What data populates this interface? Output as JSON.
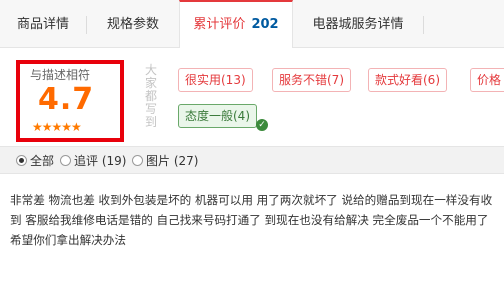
{
  "tabs": [
    {
      "label": "商品详情"
    },
    {
      "label": "规格参数"
    },
    {
      "label": "累计评价",
      "count": "202"
    },
    {
      "label": "电器城服务详情"
    }
  ],
  "rating": {
    "label": "与描述相符",
    "score": "4.7",
    "stars": 4.7,
    "stars_glyph": "★★★★★"
  },
  "vertical_label": "大家都写到",
  "tags": [
    {
      "label": "很实用(13)"
    },
    {
      "label": "服务不错(7)"
    },
    {
      "label": "款式好看(6)"
    },
    {
      "label": "价格"
    },
    {
      "label": "态度一般(4)",
      "selected": true
    }
  ],
  "filters": [
    {
      "label": "全部",
      "checked": true
    },
    {
      "label": "追评 (19)",
      "checked": false
    },
    {
      "label": "图片 (27)",
      "checked": false
    }
  ],
  "review": {
    "text": "非常差 物流也差 收到外包装是坏的 机器可以用 用了两次就坏了 说给的赠品到现在一样没有收到 客服给我维修电话是错的 自己找来号码打通了 到现在也没有给解决 完全废品一个不能用了 希望你们拿出解决办法"
  },
  "colors": {
    "accent_red": "#e4393c",
    "score_orange": "#ff6a00",
    "count_blue": "#005aa0",
    "highlight_box": "#e8000b",
    "selected_tag_green": "#3b8a3b"
  }
}
